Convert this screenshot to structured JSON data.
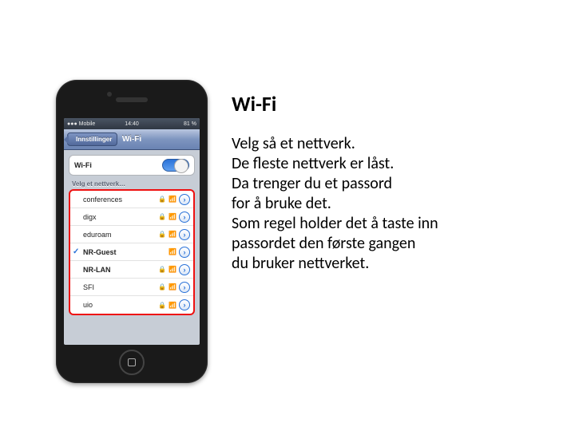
{
  "heading": "Wi-Fi",
  "body": {
    "l1": "Velg så et nettverk.",
    "l2": "De fleste nettverk er låst.",
    "l3": "Da trenger du et passord",
    "l4": "for å bruke det.",
    "l5": "Som regel holder det å taste inn",
    "l6": "passordet den første gangen",
    "l7": "du bruker nettverket."
  },
  "phone": {
    "status": {
      "carrier": "●●● Mobile",
      "signal": "●●●",
      "time": "14:40",
      "battery": "81 %"
    },
    "nav": {
      "back": "Innstillinger",
      "title": "Wi-Fi"
    },
    "wifi_toggle": {
      "label": "Wi-Fi",
      "on": true
    },
    "section_label": "Velg et nettverk…",
    "networks": [
      {
        "name": "conferences",
        "locked": true,
        "selected": false,
        "bold": false
      },
      {
        "name": "digx",
        "locked": true,
        "selected": false,
        "bold": false
      },
      {
        "name": "eduroam",
        "locked": true,
        "selected": false,
        "bold": false
      },
      {
        "name": "NR-Guest",
        "locked": false,
        "selected": true,
        "bold": true
      },
      {
        "name": "NR-LAN",
        "locked": true,
        "selected": false,
        "bold": true
      },
      {
        "name": "SFI",
        "locked": true,
        "selected": false,
        "bold": false
      },
      {
        "name": "uio",
        "locked": true,
        "selected": false,
        "bold": false
      }
    ]
  }
}
